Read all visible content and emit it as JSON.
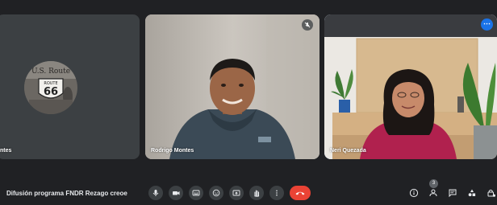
{
  "meeting": {
    "title": "Difusión programa FNDR Rezago creoe"
  },
  "participants": [
    {
      "name": "ntes",
      "type": "avatar",
      "avatar_text": [
        "U.S. Route",
        "ROUTE",
        "66"
      ]
    },
    {
      "name": "Rodrigo Montes",
      "type": "video",
      "muted": true
    },
    {
      "name": "Neri Quezada",
      "type": "video",
      "active_speaker": true
    }
  ],
  "toolbar": {
    "buttons": [
      "mic-icon",
      "camera-icon",
      "captions-icon",
      "emoji-icon",
      "present-icon",
      "raise-hand-icon",
      "more-options-icon",
      "end-call-icon"
    ],
    "end_call_color": "#ea4335"
  },
  "side_controls": {
    "buttons": [
      "info-icon",
      "people-icon",
      "chat-icon",
      "activities-icon",
      "host-controls-icon"
    ],
    "people_count": "3"
  },
  "colors": {
    "background": "#202124",
    "tile": "#3c4043",
    "active_border": "#8ab4f8",
    "accent": "#1a73e8"
  }
}
